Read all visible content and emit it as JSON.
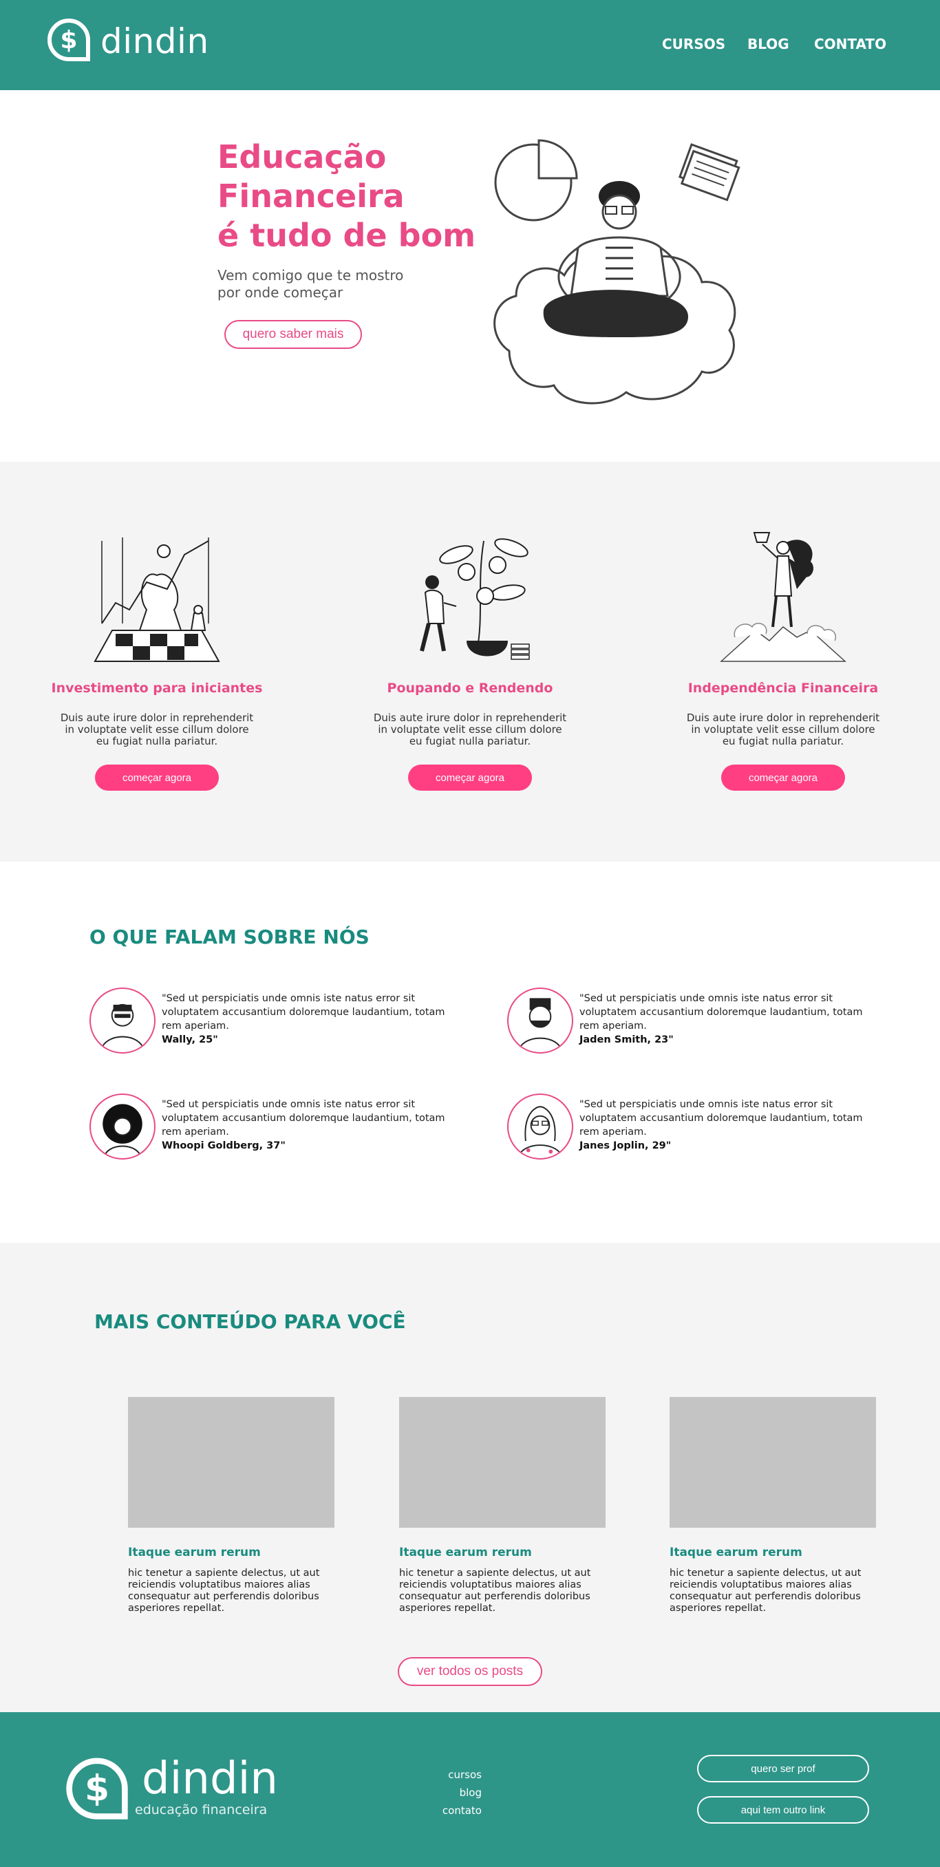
{
  "header": {
    "logo_text": "dindin",
    "nav": [
      {
        "label": "CURSOS"
      },
      {
        "label": "BLOG"
      },
      {
        "label": "CONTATO"
      }
    ]
  },
  "hero": {
    "title_lines": [
      "Educação",
      "Financeira",
      "é tudo de bom"
    ],
    "subtitle_lines": [
      "Vem comigo que te mostro",
      "por onde começar"
    ],
    "cta": "quero saber mais"
  },
  "features": [
    {
      "title": "Investimento para iniciantes",
      "description": "Duis aute irure dolor in reprehenderit in voluptate velit esse cillum dolore eu fugiat nulla pariatur.",
      "button": "começar agora"
    },
    {
      "title": "Poupando e Rendendo",
      "description": "Duis aute irure dolor in reprehenderit in voluptate velit esse cillum dolore eu fugiat nulla pariatur.",
      "button": "começar agora"
    },
    {
      "title": "Independência Financeira",
      "description": "Duis aute irure dolor in reprehenderit in voluptate velit esse cillum dolore eu fugiat nulla pariatur.",
      "button": "começar agora"
    }
  ],
  "testimonials": {
    "title": "O QUE FALAM SOBRE NÓS",
    "items": [
      {
        "quote": "\"Sed ut perspiciatis unde omnis iste natus error sit voluptatem accusantium doloremque laudantium, totam rem aperiam.",
        "author": "Wally, 25\""
      },
      {
        "quote": "\"Sed ut perspiciatis unde omnis iste natus error sit voluptatem accusantium doloremque laudantium, totam rem aperiam.",
        "author": "Jaden Smith, 23\""
      },
      {
        "quote": "\"Sed ut perspiciatis unde omnis iste natus error sit voluptatem accusantium doloremque laudantium, totam rem aperiam.",
        "author": "Whoopi Goldberg, 37\""
      },
      {
        "quote": "\"Sed ut perspiciatis unde omnis iste natus error sit voluptatem accusantium doloremque laudantium, totam rem aperiam.",
        "author": "Janes Joplin, 29\""
      }
    ]
  },
  "posts": {
    "title": "MAIS CONTEÚDO PARA VOCÊ",
    "items": [
      {
        "title": "Itaque earum rerum",
        "body": "hic tenetur a sapiente delectus, ut aut reiciendis voluptatibus maiores alias consequatur aut perferendis doloribus asperiores repellat."
      },
      {
        "title": "Itaque earum rerum",
        "body": "hic tenetur a sapiente delectus, ut aut reiciendis voluptatibus maiores alias consequatur aut perferendis doloribus asperiores repellat."
      },
      {
        "title": "Itaque earum rerum",
        "body": "hic tenetur a sapiente delectus, ut aut reiciendis voluptatibus maiores alias consequatur aut perferendis doloribus asperiores repellat."
      }
    ],
    "button": "ver todos os posts"
  },
  "footer": {
    "logo_text": "dindin",
    "tagline": "educação financeira",
    "links": [
      "cursos",
      "blog",
      "contato"
    ],
    "buttons": [
      "quero ser prof",
      "aqui tem outro link"
    ]
  },
  "colors": {
    "teal": "#2e9589",
    "teal_text": "#198b7f",
    "pink": "#e94b86",
    "pink_button": "#ff3f82",
    "light_gray": "#f4f4f4",
    "placeholder_gray": "#c4c4c4"
  },
  "icons": [
    "dollar-logo-icon",
    "meditating-person-illustration",
    "chess-unicorn-illustration",
    "money-plant-illustration",
    "trophy-mountain-illustration"
  ]
}
